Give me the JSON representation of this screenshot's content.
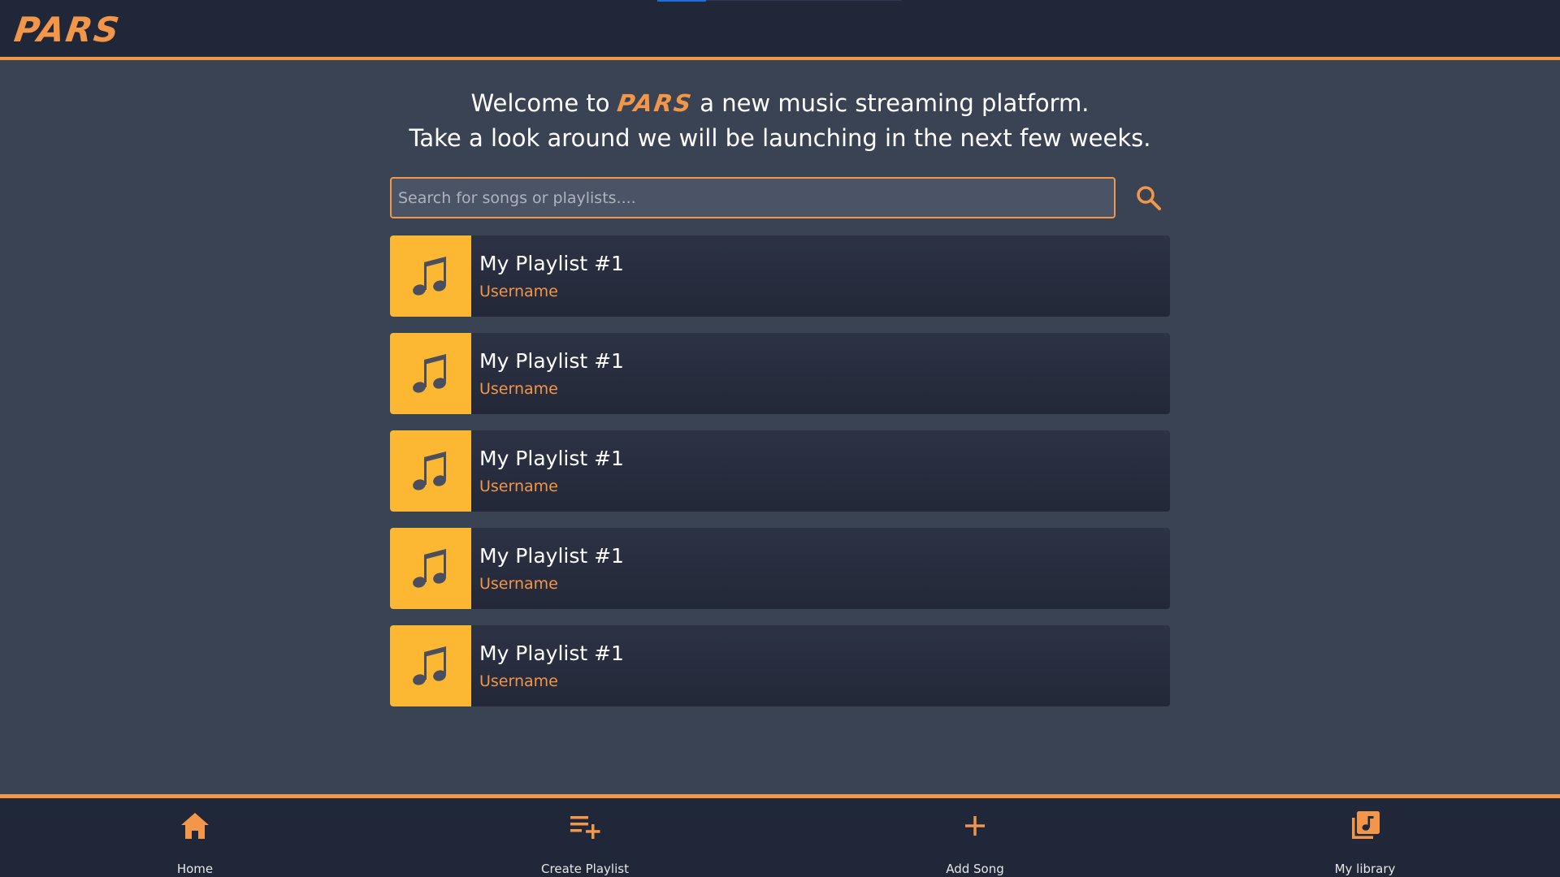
{
  "header": {
    "logo_text": "PARS"
  },
  "welcome": {
    "line1_before": "Welcome to",
    "line1_brand": "PARS",
    "line1_after": "a new music streaming platform.",
    "line2": "Take a look around we will be launching in the next few weeks."
  },
  "search": {
    "placeholder": "Search for songs or playlists....",
    "value": ""
  },
  "playlists": [
    {
      "title": "My Playlist #1",
      "user": "Username"
    },
    {
      "title": "My Playlist #1",
      "user": "Username"
    },
    {
      "title": "My Playlist #1",
      "user": "Username"
    },
    {
      "title": "My Playlist #1",
      "user": "Username"
    },
    {
      "title": "My Playlist #1",
      "user": "Username"
    }
  ],
  "bottom_nav": [
    {
      "label": "Home",
      "icon": "home-icon"
    },
    {
      "label": "Create Playlist",
      "icon": "playlist-add-icon"
    },
    {
      "label": "Add Song",
      "icon": "plus-icon"
    },
    {
      "label": "My library",
      "icon": "library-music-icon"
    }
  ],
  "colors": {
    "accent": "#f2964a",
    "thumb": "#fcb833",
    "bar_bg": "#1f2738",
    "page_bg": "#3a4354"
  }
}
